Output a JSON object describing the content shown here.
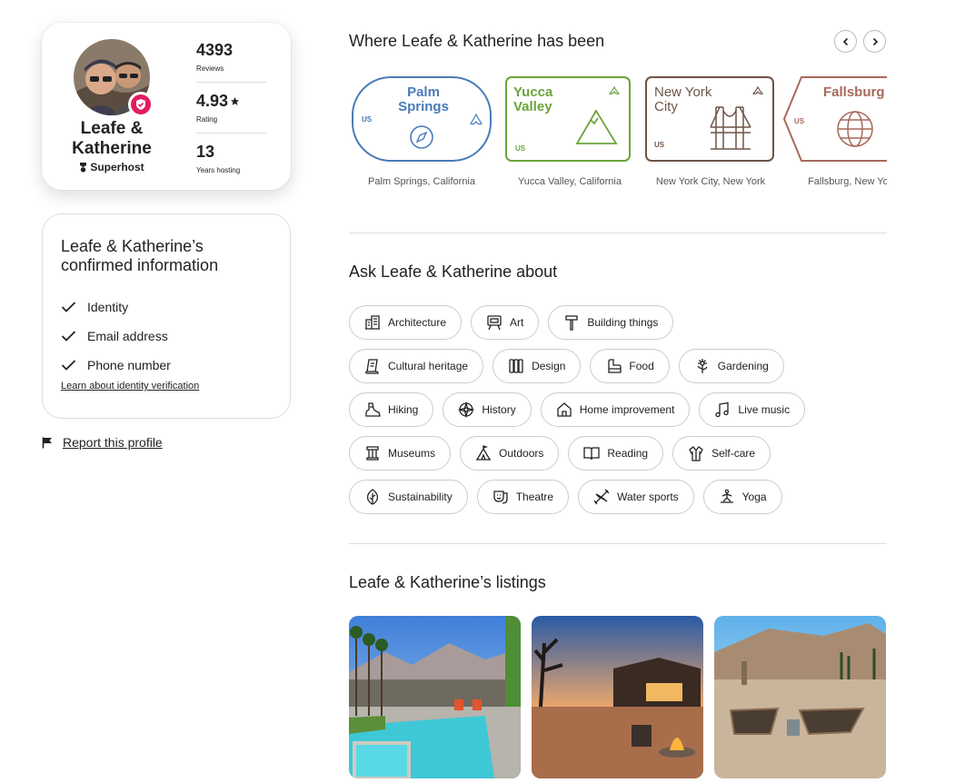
{
  "host": {
    "name": "Leafe & Katherine",
    "superhost_label": "Superhost",
    "stats": [
      {
        "value": "4393",
        "label": "Reviews"
      },
      {
        "value": "4.93",
        "label": "Rating"
      },
      {
        "value": "13",
        "label": "Years hosting"
      }
    ]
  },
  "confirmed": {
    "title": "Leafe & Katherine’s confirmed information",
    "items": [
      "Identity",
      "Email address",
      "Phone number"
    ],
    "learn_link": "Learn about identity verification"
  },
  "report_label": "Report this profile",
  "travel": {
    "title": "Where Leafe & Katherine has been",
    "stamps": [
      {
        "place": "Palm Springs",
        "country": "US",
        "caption": "Palm Springs, California",
        "color": "#4a7bb8"
      },
      {
        "place": "Yucca Valley",
        "country": "US",
        "caption": "Yucca Valley, California",
        "color": "#6aa43a"
      },
      {
        "place": "New York City",
        "country": "US",
        "caption": "New York City, New York",
        "color": "#6e5548"
      },
      {
        "place": "Fallsburg",
        "country": "US",
        "caption": "Fallsburg, New York",
        "color": "#a8695a"
      }
    ]
  },
  "interests": {
    "title": "Ask Leafe & Katherine about",
    "rows": [
      [
        {
          "label": "Architecture",
          "icon": "building-icon"
        },
        {
          "label": "Art",
          "icon": "easel-icon"
        },
        {
          "label": "Building things",
          "icon": "hammer-icon"
        }
      ],
      [
        {
          "label": "Cultural heritage",
          "icon": "scroll-icon"
        },
        {
          "label": "Design",
          "icon": "swatches-icon"
        },
        {
          "label": "Food",
          "icon": "chef-hat-icon"
        },
        {
          "label": "Gardening",
          "icon": "flower-icon"
        }
      ],
      [
        {
          "label": "Hiking",
          "icon": "hiking-boot-icon"
        },
        {
          "label": "History",
          "icon": "compass-rose-icon"
        },
        {
          "label": "Home improvement",
          "icon": "house-icon"
        },
        {
          "label": "Live music",
          "icon": "music-note-icon"
        }
      ],
      [
        {
          "label": "Museums",
          "icon": "column-icon"
        },
        {
          "label": "Outdoors",
          "icon": "tent-icon"
        },
        {
          "label": "Reading",
          "icon": "book-icon"
        },
        {
          "label": "Self-care",
          "icon": "robe-icon"
        }
      ],
      [
        {
          "label": "Sustainability",
          "icon": "leaf-icon"
        },
        {
          "label": "Theatre",
          "icon": "mask-icon"
        },
        {
          "label": "Water sports",
          "icon": "kayak-icon"
        },
        {
          "label": "Yoga",
          "icon": "yoga-icon"
        }
      ]
    ]
  },
  "listings": {
    "title": "Leafe & Katherine’s listings"
  },
  "colors": {
    "brand": "#e31c5f",
    "text": "#222222",
    "border": "#dddddd"
  }
}
